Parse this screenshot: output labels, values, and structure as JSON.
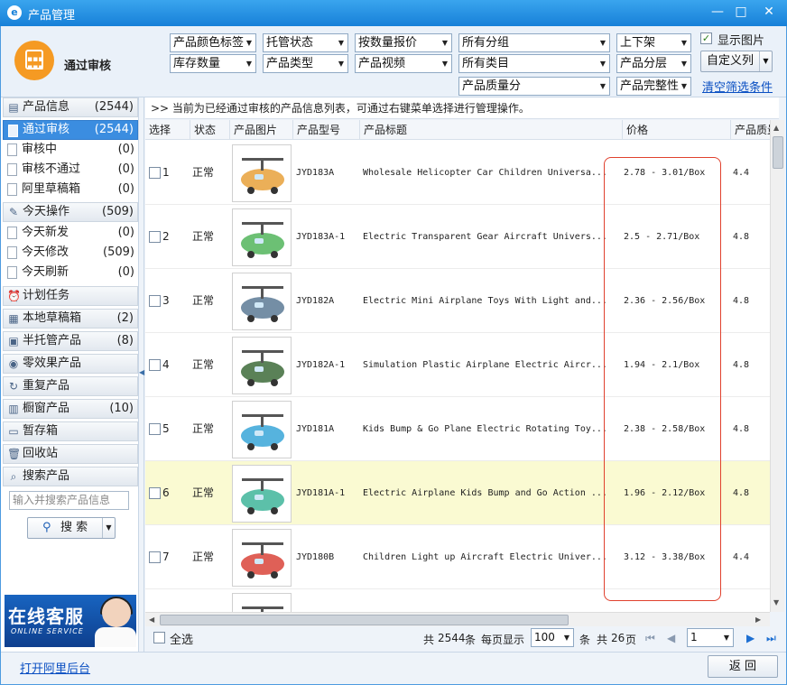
{
  "window": {
    "title": "产品管理",
    "minimize": "—",
    "maximize": "□",
    "close": "✕"
  },
  "header": {
    "title": "通过审核",
    "filters_row1": [
      "产品颜色标签",
      "托管状态",
      "按数量报价",
      "所有分组",
      "上下架"
    ],
    "filters_row2": [
      "库存数量",
      "产品类型",
      "产品视频",
      "所有类目",
      "产品分层"
    ],
    "filters_row3": [
      "产品质量分",
      "产品完整性"
    ],
    "show_images": {
      "label": "显示图片",
      "checked": true
    },
    "custom_columns": "自定义列",
    "clear_filters": "清空筛选条件"
  },
  "sidebar": {
    "groups": [
      {
        "label": "产品信息",
        "count": "(2544)",
        "icon": "product-info-icon"
      },
      {
        "label": "今天操作",
        "count": "(509)",
        "icon": "edit-icon"
      },
      {
        "label": "计划任务",
        "count": "",
        "icon": "alarm-clock-icon"
      },
      {
        "label": "本地草稿箱",
        "count": "(2)",
        "icon": "drafts-icon"
      },
      {
        "label": "半托管产品",
        "count": "(8)",
        "icon": "semi-managed-icon"
      },
      {
        "label": "零效果产品",
        "count": "",
        "icon": "eye-icon"
      },
      {
        "label": "重复产品",
        "count": "",
        "icon": "refresh-icon"
      },
      {
        "label": "橱窗产品",
        "count": "(10)",
        "icon": "showcase-icon"
      },
      {
        "label": "暂存箱",
        "count": "",
        "icon": "folder-icon"
      },
      {
        "label": "回收站",
        "count": "",
        "icon": "trash-icon"
      },
      {
        "label": "搜索产品",
        "count": "",
        "icon": "search-icon"
      }
    ],
    "product_items": [
      {
        "label": "通过审核",
        "count": "(2544)",
        "selected": true
      },
      {
        "label": "审核中",
        "count": "(0)"
      },
      {
        "label": "审核不通过",
        "count": "(0)"
      },
      {
        "label": "阿里草稿箱",
        "count": "(0)"
      }
    ],
    "today_items": [
      {
        "label": "今天新发",
        "count": "(0)"
      },
      {
        "label": "今天修改",
        "count": "(509)"
      },
      {
        "label": "今天刷新",
        "count": "(0)"
      }
    ],
    "search_placeholder": "输入并搜索产品信息",
    "search_button": "搜 索",
    "banner": {
      "title": "在线客服",
      "subtitle": "ONLINE SERVICE"
    }
  },
  "info_bar": ">>  当前为已经通过审核的产品信息列表，可通过右键菜单选择进行管理操作。",
  "table": {
    "columns": [
      "选择",
      "状态",
      "产品图片",
      "产品型号",
      "产品标题",
      "价格",
      "产品质量分"
    ],
    "rows": [
      {
        "num": "1",
        "status": "正常",
        "model": "JYD183A",
        "title": "Wholesale Helicopter Car Children Universa...",
        "price": "2.78 - 3.01/Box",
        "score": "4.4",
        "color": "#e7a13b"
      },
      {
        "num": "2",
        "status": "正常",
        "model": "JYD183A-1",
        "title": "Electric Transparent Gear Aircraft Univers...",
        "price": "2.5 - 2.71/Box",
        "score": "4.8",
        "color": "#52b55c"
      },
      {
        "num": "3",
        "status": "正常",
        "model": "JYD182A",
        "title": "Electric Mini Airplane Toys With Light and...",
        "price": "2.36 - 2.56/Box",
        "score": "4.8",
        "color": "#5c7a95"
      },
      {
        "num": "4",
        "status": "正常",
        "model": "JYD182A-1",
        "title": "Simulation Plastic Airplane Electric Aircr...",
        "price": "1.94 - 2.1/Box",
        "score": "4.8",
        "color": "#3d6b3a"
      },
      {
        "num": "5",
        "status": "正常",
        "model": "JYD181A",
        "title": "Kids Bump & Go Plane Electric Rotating Toy...",
        "price": "2.38 - 2.58/Box",
        "score": "4.8",
        "color": "#38a6d8"
      },
      {
        "num": "6",
        "status": "正常",
        "model": "JYD181A-1",
        "title": "Electric Airplane Kids Bump and Go Action ...",
        "price": "1.96 - 2.12/Box",
        "score": "4.8",
        "color": "#3fb59a",
        "highlight": true
      },
      {
        "num": "7",
        "status": "正常",
        "model": "JYD180B",
        "title": "Children Light up Aircraft Electric Univer...",
        "price": "3.12 - 3.38/Box",
        "score": "4.4",
        "color": "#d9443a"
      },
      {
        "num": "",
        "status": "",
        "model": "",
        "title": "",
        "price": "",
        "score": "",
        "color": "#b0a08a"
      }
    ]
  },
  "footer": {
    "select_all": "全选",
    "total_prefix": "共",
    "total": "2544",
    "total_suffix": "条",
    "per_page_label": "每页显示",
    "per_page": "100",
    "per_page_suffix": "条",
    "pages_prefix": "共",
    "pages": "26",
    "pages_suffix": "页",
    "current_page": "1"
  },
  "bottom": {
    "open_backend": "打开阿里后台",
    "back": "返 回"
  }
}
